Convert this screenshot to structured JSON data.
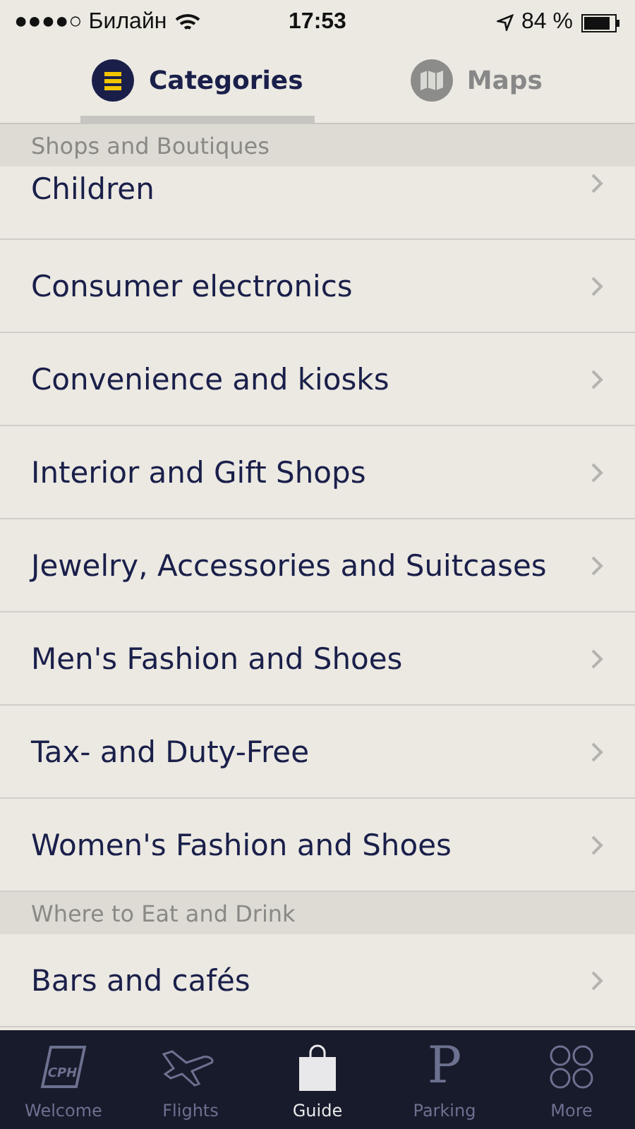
{
  "status_bar": {
    "carrier": "●●●●○ Билайн",
    "time": "17:53",
    "battery": "84 %"
  },
  "tabs": [
    {
      "label": "Categories",
      "selected": true,
      "kind": "categories"
    },
    {
      "label": "Maps",
      "selected": false,
      "kind": "maps"
    }
  ],
  "sections": [
    {
      "title": "Shops and Boutiques",
      "items": [
        "Children",
        "Consumer electronics",
        "Convenience and kiosks",
        "Interior and Gift Shops",
        "Jewelry, Accessories and Suitcases",
        "Men's Fashion and Shoes",
        "Tax- and Duty-Free",
        "Women's Fashion and Shoes"
      ]
    },
    {
      "title": "Where to Eat and Drink",
      "items": [
        "Bars and cafés"
      ]
    }
  ],
  "tab_bar": [
    {
      "label": "Welcome",
      "kind": "welcome",
      "logo_text": "CPH",
      "selected": false
    },
    {
      "label": "Flights",
      "kind": "flights",
      "selected": false
    },
    {
      "label": "Guide",
      "kind": "guide",
      "selected": true
    },
    {
      "label": "Parking",
      "kind": "parking",
      "glyph": "P",
      "selected": false
    },
    {
      "label": "More",
      "kind": "more",
      "selected": false
    }
  ]
}
